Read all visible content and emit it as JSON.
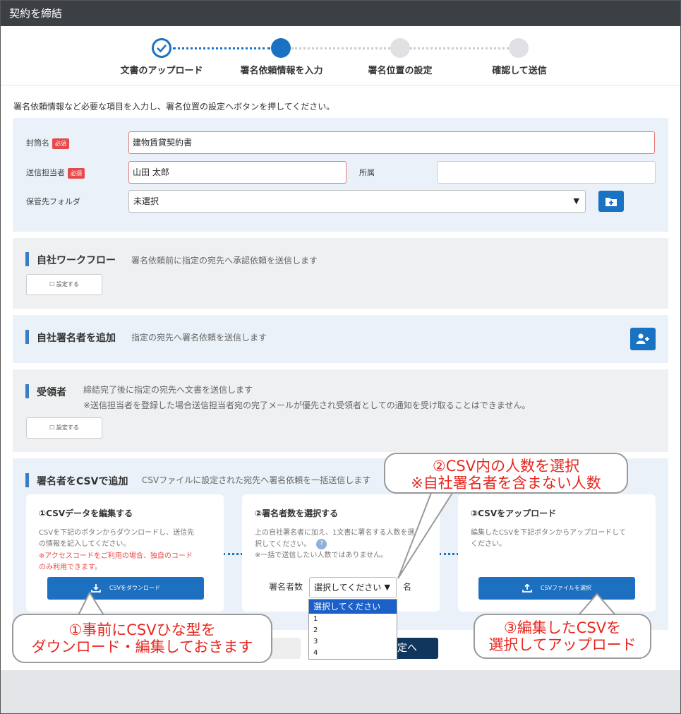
{
  "window_title": "契約を締結",
  "steps": [
    {
      "label": "文書のアップロード",
      "state": "done"
    },
    {
      "label": "署名依頼情報を入力",
      "state": "current"
    },
    {
      "label": "署名位置の設定",
      "state": "todo"
    },
    {
      "label": "確認して送信",
      "state": "todo"
    }
  ],
  "intro": "署名依頼情報など必要な項目を入力し、署名位置の設定へボタンを押してください。",
  "form": {
    "envelope_label": "封筒名",
    "required_badge": "必須",
    "envelope_value": "建物賃貸契約書",
    "sender_label": "送信担当者",
    "sender_value": "山田 太郎",
    "affiliation_label": "所属",
    "affiliation_value": "",
    "folder_label": "保管先フォルダ",
    "folder_value": "未選択"
  },
  "workflow": {
    "title": "自社ワークフロー",
    "desc": "署名依頼前に指定の宛先へ承認依頼を送信します",
    "button": "☐ 設定する"
  },
  "add_signer": {
    "title": "自社署名者を追加",
    "desc": "指定の宛先へ署名依頼を送信します"
  },
  "recipient": {
    "title": "受領者",
    "desc1": "締結完了後に指定の宛先へ文書を送信します",
    "desc2": "※送信担当者を登録した場合送信担当者宛の完了メールが優先され受領者としての通知を受け取ることはできません。",
    "button": "☐ 設定する"
  },
  "csv": {
    "title": "署名者をCSVで追加",
    "desc": "CSVファイルに設定された宛先へ署名依頼を一括送信します",
    "card1": {
      "title": "①CSVデータを編集する",
      "text1": "CSVを下記のボタンからダウンロードし、送信先",
      "text2": "の情報を記入してください。",
      "note1": "※アクセスコードをご利用の場合、独自のコード",
      "note2": "のみ利用できます。",
      "button": "CSVをダウンロード"
    },
    "card2": {
      "title": "②署名者数を選択する",
      "text1": "上の自社署名者に加え、1文書に署名する人数を選",
      "text2": "択してください。",
      "help": "?",
      "text3": "※一括で送信したい人数ではありません。",
      "count_label": "署名者数",
      "select_value": "選択してください",
      "unit": "名"
    },
    "card3": {
      "title": "③CSVをアップロード",
      "text1": "編集したCSVを下記ボタンからアップロードして",
      "text2": "ください。",
      "button": "CSVファイルを選択"
    }
  },
  "dropdown_options": [
    "選択してください",
    "1",
    "2",
    "3",
    "4"
  ],
  "footer": {
    "back_fragment": "る",
    "next_fragment": "定へ"
  },
  "callouts": {
    "c1_line1": "①事前にCSVひな型を",
    "c1_line2": "ダウンロード・編集しておきます",
    "c2_line1": "②CSV内の人数を選択",
    "c2_line2": "※自社署名者を含まない人数",
    "c3_line1": "③編集したCSVを",
    "c3_line2": "選択してアップロード"
  },
  "colors": {
    "accent": "#1a73c2",
    "required": "#e84a4a",
    "callout_text": "#e8271f",
    "titlebar": "#3c4044"
  }
}
